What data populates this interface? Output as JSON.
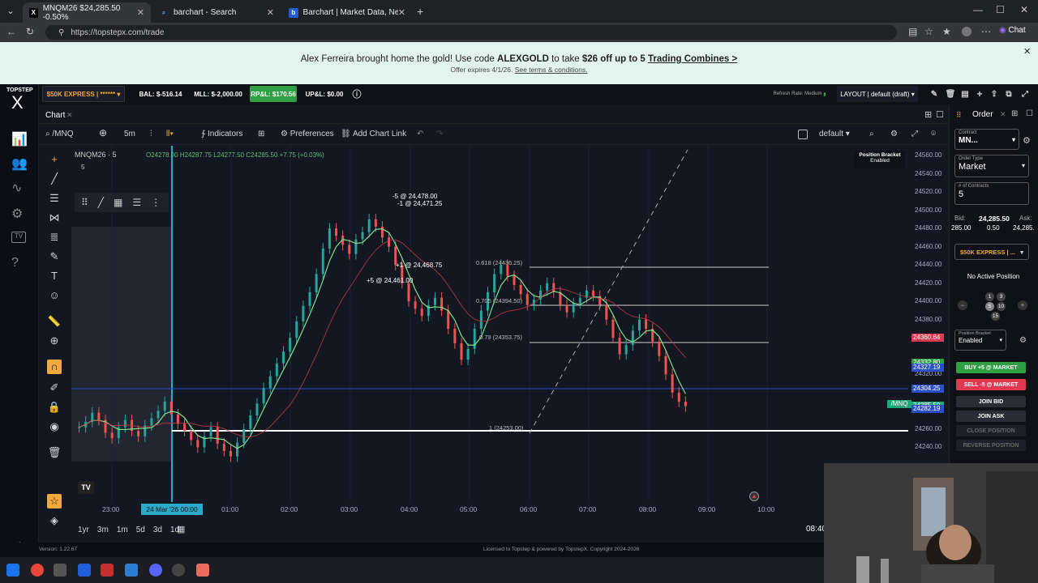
{
  "browser": {
    "tabs": [
      {
        "label": "MNQM26 $24,285.50 -0.50%",
        "active": true,
        "favicon": "X"
      },
      {
        "label": "barchart - Search",
        "active": false,
        "favicon": "Q"
      },
      {
        "label": "Barchart | Market Data, News, Trad",
        "active": false,
        "favicon": "b"
      }
    ],
    "url": "https://topstepx.com/trade",
    "chat_label": "Chat"
  },
  "banner": {
    "prefix": "Alex Ferreira brought home the gold! Use code ",
    "code": "ALEXGOLD",
    "middle": " to take ",
    "offer": "$26 off up to 5",
    "link": "Trading Combines >",
    "sub": "Offer expires 4/1/26.",
    "terms": "See terms & conditions."
  },
  "topbar": {
    "brand_top": "TOPSTEP",
    "brand_x": "X",
    "account": "$50K EXPRESS | ******",
    "bal": "BAL: $-516.14",
    "mll": "MLL: $-2,000.00",
    "rpl": "RP&L: $170.56",
    "upl": "UP&L: $0.00",
    "refresh": "Refresh Rate: Medium",
    "layout": "LAYOUT | default (draft)"
  },
  "chart": {
    "tab": "Chart",
    "symbol": "/MNQ",
    "interval": "5m",
    "indicators": "Indicators",
    "preferences": "Preferences",
    "add_link": "Add Chart Link",
    "template": "default",
    "legend_title": "MNQM26 · 5",
    "legend_sub": "5",
    "ohlc": {
      "o": "O24278.00",
      "h": "H24287.75",
      "l": "L24277.50",
      "c": "C24285.50 +7.75 (+0.03%)"
    },
    "bracket_title": "Position Bracket",
    "bracket_state": "Enabled",
    "price_labels": [
      "24560.00",
      "24540.00",
      "24520.00",
      "24500.00",
      "24480.00",
      "24460.00",
      "24440.00",
      "24420.00",
      "24400.00",
      "24380.00",
      "24320.00",
      "24260.00",
      "24240.00"
    ],
    "price_tags": [
      {
        "value": "24360.64",
        "color": "#e03a52"
      },
      {
        "value": "24332.80",
        "color": "#2ea043"
      },
      {
        "value": "24327.19",
        "color": "#2a4fc9"
      },
      {
        "value": "24304.25",
        "color": "#2a4fc9"
      },
      {
        "value": "24285.50",
        "color": "#1fa87a"
      },
      {
        "value": "24282.19",
        "color": "#2a4fc9"
      }
    ],
    "symbol_tag": "/MNQ",
    "time_labels": [
      "23:00",
      "01:00",
      "02:00",
      "03:00",
      "04:00",
      "05:00",
      "06:00",
      "07:00",
      "08:00",
      "09:00",
      "10:00"
    ],
    "time_highlight": "24 Mar '26  00:00",
    "ranges": [
      "1yr",
      "3m",
      "1m",
      "5d",
      "3d",
      "1d"
    ],
    "clock": "08:40",
    "annotations": {
      "a1": "-5 @ 24,478.00",
      "a2": "-1 @ 24,471.25",
      "a3": "+1 @ 24,468.75",
      "a4": "+5 @ 24,461.00"
    },
    "fib": {
      "f618": "0.618 (24436.25)",
      "f705": "0.705 (24394.50)",
      "f79": "0.79 (24353.75)",
      "f1": "1 (24253.00)"
    }
  },
  "order_panel": {
    "title": "Order",
    "contract_label": "Contract",
    "contract": "MN...",
    "order_type_label": "Order Type",
    "order_type": "Market",
    "contracts_label": "# of Contracts",
    "contracts": "5",
    "bid_label": "Bid:",
    "ask_label": "Ask:",
    "bid": "285.00",
    "last": "24,285.50",
    "spread": "0.50",
    "ask": "24,285.",
    "account": "$50K EXPRESS | ...",
    "no_position": "No Active Position",
    "qty": [
      "1",
      "3",
      "5",
      "10",
      "15"
    ],
    "bracket_label": "Position Bracket",
    "bracket": "Enabled",
    "buy": "BUY +5 @ MARKET",
    "sell": "SELL -5 @ MARKET",
    "join_bid": "JOIN BID",
    "join_ask": "JOIN ASK",
    "close": "CLOSE POSITION",
    "reverse": "REVERSE POSITION"
  },
  "status": {
    "version": "Version: 1.22.67",
    "license": "Licensed to Topstep & powered by TopstepX. Copyright 2024-2026"
  }
}
